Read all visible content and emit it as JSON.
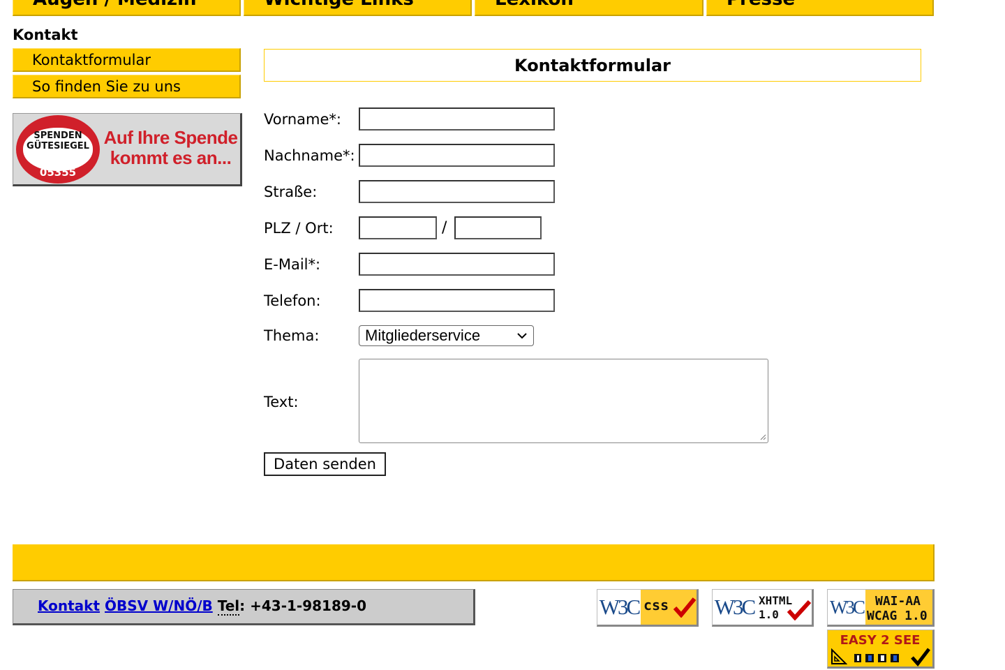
{
  "topnav": {
    "tabs": [
      {
        "label": "Augen / Medizin"
      },
      {
        "label": "Wichtige Links"
      },
      {
        "label": "Lexikon"
      },
      {
        "label": "Presse"
      }
    ]
  },
  "section_title": "Kontakt",
  "subnav": {
    "items": [
      {
        "label": "Kontaktformular"
      },
      {
        "label": "So finden Sie zu uns"
      }
    ]
  },
  "banner": {
    "seal_line1": "SPENDEN",
    "seal_line2": "GÜTESIEGEL",
    "seal_number": "05355",
    "text_line1": "Auf Ihre Spende",
    "text_line2": "kommt es an..."
  },
  "form": {
    "title": "Kontaktformular",
    "labels": {
      "vorname": "Vorname*:",
      "nachname": "Nachname*:",
      "strasse": "Straße:",
      "plz_ort": "PLZ / Ort:",
      "email": "E-Mail*:",
      "telefon": "Telefon:",
      "thema": "Thema:",
      "text": "Text:"
    },
    "slash": "/",
    "thema_selected": "Mitgliederservice",
    "submit_label": "Daten senden"
  },
  "footer": {
    "contact_link": "Kontakt",
    "org_link": "ÖBSV W/NÖ/B",
    "tel_abbr": "Tel",
    "tel_number": ": +43-1-98189-0"
  },
  "badges": {
    "css": {
      "w3c": "W3C",
      "label": "css"
    },
    "xhtml": {
      "w3c": "W3C",
      "line1": "XHTML",
      "line2": "1.0"
    },
    "wai": {
      "w3c": "W3C",
      "line1": "WAI-AA",
      "line2": "WCAG 1.0"
    },
    "easy": {
      "label": "EASY 2 SEE"
    }
  }
}
